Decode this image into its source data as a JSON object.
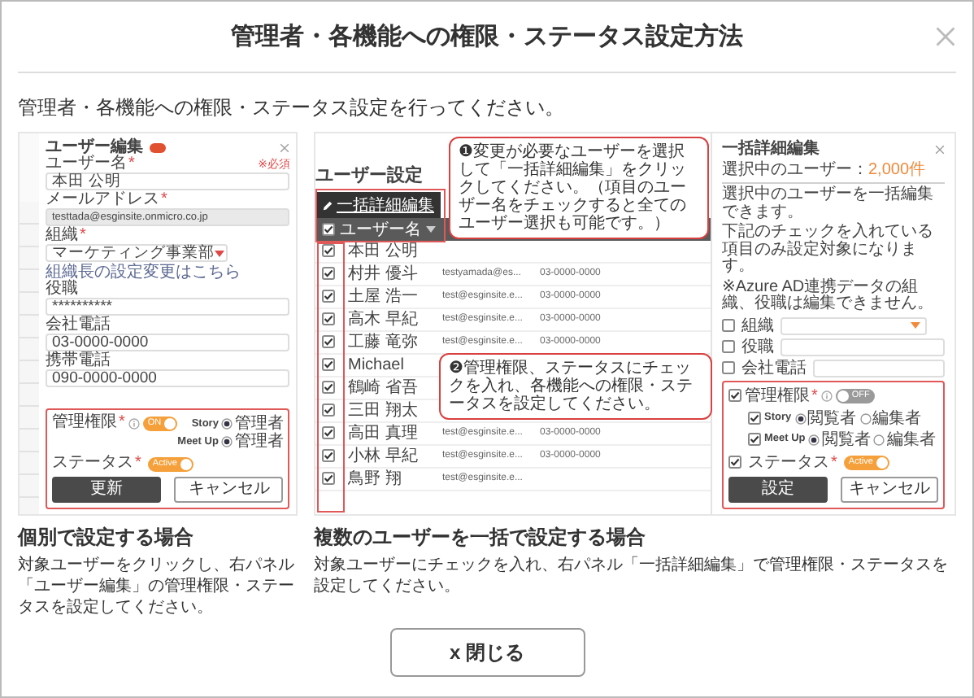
{
  "dialog": {
    "title": "管理者・各機能への権限・ステータス設定方法",
    "intro": "管理者・各機能への権限・ステータス設定を行ってください。"
  },
  "examples": [
    {
      "kind": "single",
      "heading": "個別で設定する場合",
      "description": "対象ユーザーをクリックし、右パネル「ユーザー編集」の管理権限・ステータスを設定してください。",
      "panel": {
        "title": "ユーザー編集",
        "fields": [
          {
            "kind": "input",
            "label": "ユーザー名",
            "mark": "*",
            "note": "※必須",
            "value": "本田 公明"
          },
          {
            "kind": "readonly",
            "label": "メールアドレス",
            "mark": "*",
            "value": "testtada@esginsite.onmicro.co.jp"
          },
          {
            "kind": "select",
            "label": "組織",
            "mark": "*",
            "value": "マーケティング事業部",
            "link": "組織長の設定変更はこちら"
          },
          {
            "kind": "input",
            "label": "役職",
            "value": "**********"
          },
          {
            "kind": "input",
            "label": "会社電話",
            "value": "03-0000-0000"
          },
          {
            "kind": "input",
            "label": "携帯電話",
            "value": "090-0000-0000"
          }
        ],
        "admin": {
          "label": "管理権限",
          "mark": "*",
          "toggle": {
            "on": true,
            "text": "ON"
          }
        },
        "roles": [
          {
            "name": "Story",
            "options": [
              {
                "label": "管理者",
                "selected": true
              }
            ]
          },
          {
            "name": "Meet Up",
            "options": [
              {
                "label": "管理者",
                "selected": true
              }
            ]
          }
        ],
        "status": {
          "label": "ステータス",
          "mark": "*",
          "toggle": {
            "on": true,
            "text": "Active"
          }
        },
        "buttons": [
          {
            "kind": "primary",
            "label": "更新"
          },
          {
            "kind": "secondary",
            "label": "キャンセル"
          }
        ]
      }
    },
    {
      "kind": "bulk",
      "heading": "複数のユーザーを一括で設定する場合",
      "description": "対象ユーザーにチェックを入れ、右パネル「一括詳細編集」で管理権限・ステータスを設定してください。",
      "table": {
        "title": "ユーザー設定",
        "action": "一括詳細編集",
        "header": "ユーザー名",
        "header_checked": true,
        "rows": [
          {
            "name": "本田 公明",
            "checked": true
          },
          {
            "name": "村井 優斗",
            "checked": true,
            "email": "testyamada@es...",
            "phone": "03-0000-0000"
          },
          {
            "name": "土屋 浩一",
            "checked": true,
            "email": "test@esginsite.e...",
            "phone": "03-0000-0000"
          },
          {
            "name": "高木 早紀",
            "checked": true,
            "email": "test@esginsite.e...",
            "phone": "03-0000-0000"
          },
          {
            "name": "工藤 竜弥",
            "checked": true,
            "email": "test@esginsite.e...",
            "phone": "03-0000-0000"
          },
          {
            "name": "Michael",
            "checked": true
          },
          {
            "name": "鶴崎 省吾",
            "checked": true
          },
          {
            "name": "三田 翔太",
            "checked": true
          },
          {
            "name": "高田 真理",
            "checked": true,
            "email": "test@esginsite.e...",
            "phone": "03-0000-0000"
          },
          {
            "name": "小林 早紀",
            "checked": true,
            "email": "test@esginsite.e...",
            "phone": "03-0000-0000"
          },
          {
            "name": "鳥野 翔",
            "checked": true,
            "email": "test@esginsite.e..."
          }
        ]
      },
      "callouts": [
        "❶変更が必要なユーザーを選択して「一括詳細編集」をクリックしてください。（項目のユーザー名をチェックすると全てのユーザー選択も可能です。）",
        "❷管理権限、ステータスにチェックを入れ、各機能への権限・ステータスを設定してください。"
      ],
      "panel": {
        "title": "一括詳細編集",
        "selected_label": "選択中のユーザー：",
        "selected_count": "2,000件",
        "notes": [
          "選択中のユーザーを一括編集できます。",
          "下記のチェックを入れている項目のみ設定対象になります。",
          "※Azure AD連携データの組織、役職は編集できません。"
        ],
        "fields": [
          {
            "kind": "select",
            "label": "組織",
            "checked": false
          },
          {
            "kind": "input",
            "label": "役職",
            "checked": false
          },
          {
            "kind": "input",
            "label": "会社電話",
            "checked": false
          }
        ],
        "admin": {
          "label": "管理権限",
          "mark": "*",
          "checked": true,
          "toggle": {
            "on": false,
            "text": "OFF"
          }
        },
        "roles": [
          {
            "name": "Story",
            "checked": true,
            "options": [
              {
                "label": "閲覧者",
                "selected": true
              },
              {
                "label": "編集者",
                "selected": false
              }
            ]
          },
          {
            "name": "Meet Up",
            "checked": true,
            "options": [
              {
                "label": "閲覧者",
                "selected": true
              },
              {
                "label": "編集者",
                "selected": false
              }
            ]
          }
        ],
        "status": {
          "label": "ステータス",
          "mark": "*",
          "checked": true,
          "toggle": {
            "on": true,
            "text": "Active"
          }
        },
        "buttons": [
          {
            "kind": "primary",
            "label": "設定"
          },
          {
            "kind": "secondary",
            "label": "キャンセル"
          }
        ]
      }
    }
  ],
  "close_button": "x 閉じる"
}
